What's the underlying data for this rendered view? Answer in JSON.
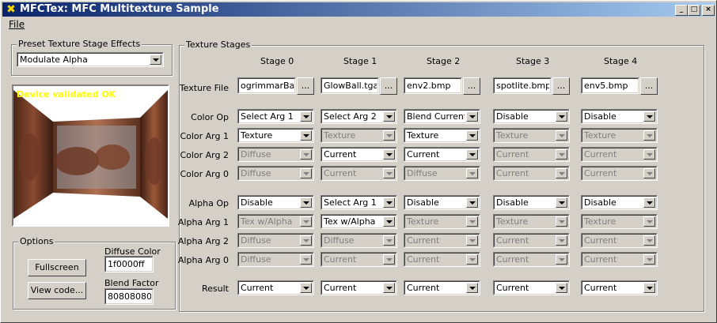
{
  "window": {
    "title": "MFCTex: MFC Multitexture Sample"
  },
  "menu": {
    "file": "File"
  },
  "preset": {
    "legend": "Preset Texture Stage Effects",
    "selected": "Modulate Alpha"
  },
  "preview": {
    "status": "Device validated OK"
  },
  "options": {
    "legend": "Options",
    "fullscreen": "Fullscreen",
    "view_code": "View code...",
    "diffuse_label": "Diffuse Color",
    "diffuse_value": "1f0000ff",
    "blend_label": "Blend Factor",
    "blend_value": "80808080"
  },
  "stages": {
    "legend": "Texture Stages",
    "headers": [
      "Stage 0",
      "Stage 1",
      "Stage 2",
      "Stage 3",
      "Stage 4"
    ],
    "row_labels": {
      "texture_file": "Texture File",
      "color_op": "Color Op",
      "color_arg1": "Color Arg 1",
      "color_arg2": "Color Arg 2",
      "color_arg0": "Color Arg 0",
      "alpha_op": "Alpha Op",
      "alpha_arg1": "Alpha Arg 1",
      "alpha_arg2": "Alpha Arg 2",
      "alpha_arg0": "Alpha Arg 0",
      "result": "Result"
    },
    "browse_label": "...",
    "texture_files": [
      "ogrimmarBanne",
      "GlowBall.tga",
      "env2.bmp",
      "spotlite.bmp",
      "env5.bmp"
    ],
    "color_op": [
      "Select Arg 1",
      "Select Arg 2",
      "Blend Current P",
      "Disable",
      "Disable"
    ],
    "color_arg1": [
      "Texture",
      "Texture",
      "Texture",
      "Texture",
      "Texture"
    ],
    "color_arg2": [
      "Diffuse",
      "Current",
      "Current",
      "Current",
      "Current"
    ],
    "color_arg0": [
      "Diffuse",
      "Current",
      "Diffuse",
      "Current",
      "Current"
    ],
    "alpha_op": [
      "Disable",
      "Select Arg 1",
      "Disable",
      "Disable",
      "Disable"
    ],
    "alpha_arg1": [
      "Tex w/Alpha",
      "Tex w/Alpha",
      "Texture",
      "Texture",
      "Texture"
    ],
    "alpha_arg2": [
      "Diffuse",
      "Diffuse",
      "Current",
      "Current",
      "Current"
    ],
    "alpha_arg0": [
      "Diffuse",
      "Current",
      "Current",
      "Current",
      "Current"
    ],
    "result": [
      "Current",
      "Current",
      "Current",
      "Current",
      "Current"
    ]
  }
}
